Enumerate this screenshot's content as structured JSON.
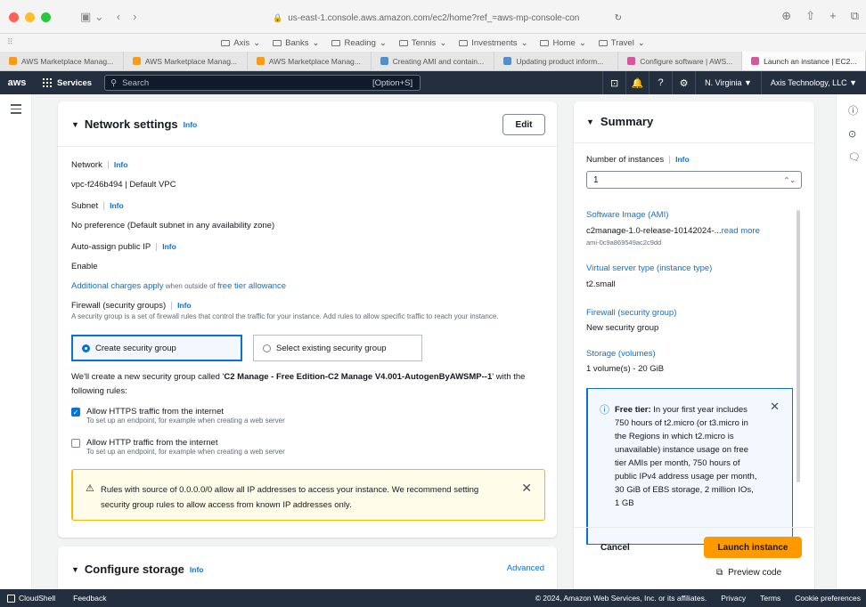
{
  "browser": {
    "url": "us-east-1.console.aws.amazon.com/ec2/home?ref_=aws-mp-console-con",
    "bookmarks": [
      "Axis",
      "Banks",
      "Reading",
      "Tennis",
      "Investments",
      "Home",
      "Travel"
    ],
    "tabs": [
      {
        "label": "AWS Marketplace Manag...",
        "favicon": "orange"
      },
      {
        "label": "AWS Marketplace Manag...",
        "favicon": "orange"
      },
      {
        "label": "AWS Marketplace Manag...",
        "favicon": "orange"
      },
      {
        "label": "Creating AMI and contain...",
        "favicon": "blue"
      },
      {
        "label": "Updating product inform...",
        "favicon": "blue"
      },
      {
        "label": "Configure software | AWS...",
        "favicon": "pink"
      },
      {
        "label": "Launch an instance | EC2...",
        "favicon": "pink",
        "active": true
      }
    ]
  },
  "aws_nav": {
    "logo": "aws",
    "services": "Services",
    "search_placeholder": "Search",
    "shortcut": "[Option+S]",
    "region": "N. Virginia ▼",
    "account": "Axis Technology, LLC ▼"
  },
  "network": {
    "title": "Network settings",
    "info": "Info",
    "edit": "Edit",
    "network_label": "Network",
    "network_value": "vpc-f246b494 | Default VPC",
    "subnet_label": "Subnet",
    "subnet_value": "No preference (Default subnet in any availability zone)",
    "public_ip_label": "Auto-assign public IP",
    "public_ip_value": "Enable",
    "charges_link": "Additional charges apply",
    "charges_mid": " when outside of ",
    "charges_link2": "free tier allowance",
    "firewall_label": "Firewall (security groups)",
    "firewall_desc": "A security group is a set of firewall rules that control the traffic for your instance. Add rules to allow specific traffic to reach your instance.",
    "create_sg": "Create security group",
    "select_sg": "Select existing security group",
    "new_sg_prefix": "We'll create a new security group called '",
    "new_sg_name": "C2 Manage - Free Edition-C2 Manage V4.001-AutogenByAWSMP--1",
    "new_sg_suffix": "' with the following rules:",
    "https_label": "Allow HTTPS traffic from the internet",
    "https_desc": "To set up an endpoint, for example when creating a web server",
    "http_label": "Allow HTTP traffic from the internet",
    "http_desc": "To set up an endpoint, for example when creating a web server",
    "warning": "Rules with source of 0.0.0.0/0 allow all IP addresses to access your instance. We recommend setting security group rules to allow access from known IP addresses only."
  },
  "storage": {
    "title": "Configure storage",
    "info": "Info",
    "advanced": "Advanced"
  },
  "summary": {
    "title": "Summary",
    "instances_label": "Number of instances",
    "info": "Info",
    "instances_value": "1",
    "ami_label": "Software Image (AMI)",
    "ami_value": "c2manage-1.0-release-10142024-...",
    "read_more": "read more",
    "ami_id": "ami-0c9a869549ac2c9dd",
    "type_label": "Virtual server type (instance type)",
    "type_value": "t2.small",
    "firewall_label": "Firewall (security group)",
    "firewall_value": "New security group",
    "storage_label": "Storage (volumes)",
    "storage_value": "1 volume(s) - 20 GiB",
    "free_tier_bold": "Free tier:",
    "free_tier_text": " In your first year includes 750 hours of t2.micro (or t3.micro in the Regions in which t2.micro is unavailable) instance usage on free tier AMIs per month, 750 hours of public IPv4 address usage per month, 30 GiB of EBS storage, 2 million IOs, 1 GB",
    "cancel": "Cancel",
    "launch": "Launch instance",
    "preview": "Preview code"
  },
  "footer": {
    "cloudshell": "CloudShell",
    "feedback": "Feedback",
    "copyright": "© 2024, Amazon Web Services, Inc. or its affiliates.",
    "privacy": "Privacy",
    "terms": "Terms",
    "cookies": "Cookie preferences"
  }
}
